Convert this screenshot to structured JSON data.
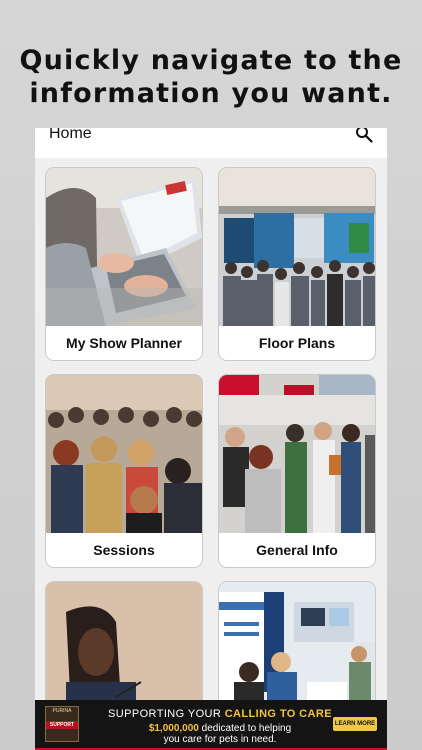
{
  "headline": {
    "line1": "Quickly navigate to the",
    "line2": "information you want."
  },
  "navbar": {
    "title": "Home",
    "search_icon": "search-icon"
  },
  "tiles": [
    {
      "label": "My Show Planner",
      "image": "person typing on laptop"
    },
    {
      "label": "Floor Plans",
      "image": "crowded exhibit hall"
    },
    {
      "label": "Sessions",
      "image": "audience in session"
    },
    {
      "label": "General Info",
      "image": "attendees at booths"
    },
    {
      "label": "",
      "image": "speaker at podium"
    },
    {
      "label": "",
      "image": "exhibitor booth"
    }
  ],
  "banner": {
    "logo_top": "PURINA",
    "logo_mid": "SUPPORT",
    "line1_prefix": "SUPPORTING YOUR ",
    "line1_emphasis": "CALLING TO CARE",
    "line2_amount": "$1,000,000",
    "line2_rest": " dedicated to helping",
    "line3": "you care for pets in need.",
    "cta_label": "LEARN MORE"
  },
  "colors": {
    "background": "#d0d0d0",
    "banner_bg": "#141414",
    "banner_accent": "#f4c23a",
    "brand_red": "#c8102e"
  }
}
